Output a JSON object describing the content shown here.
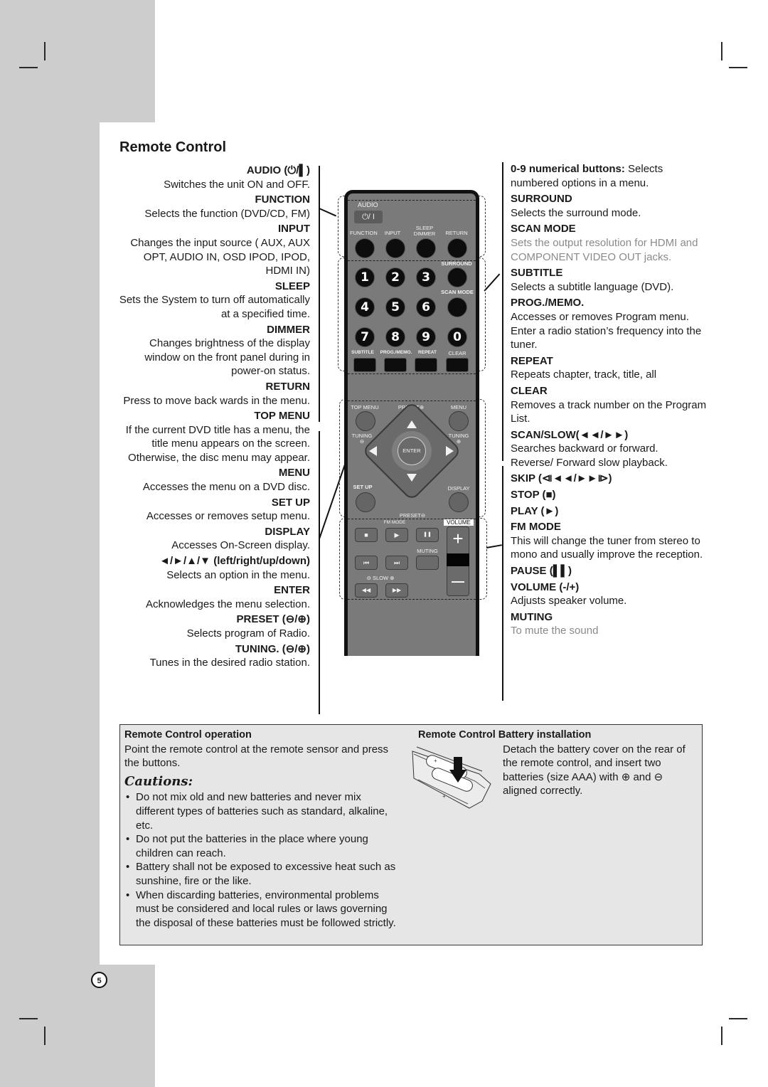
{
  "page": {
    "title": "Remote Control",
    "page_number": "5"
  },
  "left_column": [
    {
      "heading": "AUDIO (⏻/▌)",
      "desc": "Switches the unit ON and OFF."
    },
    {
      "heading": "FUNCTION",
      "desc": "Selects the function (DVD/CD, FM)"
    },
    {
      "heading": "INPUT",
      "desc": "Changes the input source ( AUX, AUX OPT, AUDIO IN, OSD IPOD, IPOD, HDMI IN)"
    },
    {
      "heading": "SLEEP",
      "desc": "Sets the System to turn off automatically at a specified time."
    },
    {
      "heading": "DIMMER",
      "desc": "Changes brightness of the display window on the front panel during in power-on status."
    },
    {
      "heading": "RETURN",
      "desc": "Press to move back wards in the menu."
    },
    {
      "heading": "TOP MENU",
      "desc": "If the current DVD title has a menu, the title menu appears on the screen. Otherwise, the disc menu may appear."
    },
    {
      "heading": "MENU",
      "desc": "Accesses the menu on a DVD disc."
    },
    {
      "heading": "SET UP",
      "desc": "Accesses or removes setup menu."
    },
    {
      "heading": "DISPLAY",
      "desc": "Accesses On-Screen display."
    },
    {
      "heading": "◄/►/▲/▼ (left/right/up/down)",
      "desc": "Selects an option in the menu."
    },
    {
      "heading": "ENTER",
      "desc": "Acknowledges the menu selection."
    },
    {
      "heading": "PRESET (⊖/⊕)",
      "desc": "Selects program of Radio."
    },
    {
      "heading": "TUNING. (⊖/⊕)",
      "desc": "Tunes in the desired radio station."
    }
  ],
  "right_column": {
    "numerical_heading": "0-9 numerical buttons:",
    "numerical_desc": " Selects numbered options in a menu.",
    "items": [
      {
        "heading": "SURROUND",
        "desc": "Selects the surround mode."
      },
      {
        "heading": "SCAN MODE",
        "desc": "Sets the output resolution for HDMI and COMPONENT VIDEO OUT jacks.",
        "gray": true
      },
      {
        "heading": "SUBTITLE",
        "desc": "Selects a subtitle language (DVD)."
      },
      {
        "heading": "PROG./MEMO.",
        "desc": "Accesses or removes Program menu.",
        "desc2": "Enter a radio station’s frequency into the tuner."
      },
      {
        "heading": "REPEAT",
        "desc": "Repeats chapter, track, title, all"
      },
      {
        "heading": "CLEAR",
        "desc": "Removes a track number on the Program List."
      },
      {
        "heading": "SCAN/SLOW(◄◄/►►)",
        "desc": "Searches backward or forward.",
        "desc2": "Reverse/ Forward slow playback."
      },
      {
        "heading": "SKIP (⧏◄◄/►►⧐)"
      },
      {
        "heading": "STOP (■)"
      },
      {
        "heading": "PLAY (►)"
      },
      {
        "heading": "FM MODE",
        "desc": "This will change the tuner from stereo to mono and usually improve the reception."
      },
      {
        "heading": "PAUSE (▌▌)"
      },
      {
        "heading": "VOLUME (-/+)",
        "desc": "Adjusts speaker volume."
      },
      {
        "heading": "MUTING",
        "desc": "To mute the sound",
        "gray": true
      }
    ]
  },
  "remote": {
    "audio": "AUDIO",
    "power": "⏻/ I",
    "function": "FUNCTION",
    "input": "INPUT",
    "sleep_dimmer": "SLEEP\nDIMMER",
    "return": "RETURN",
    "surround": "SURROUND",
    "scan_mode": "SCAN MODE",
    "digits": [
      "1",
      "2",
      "3",
      "4",
      "5",
      "6",
      "7",
      "8",
      "9",
      "0"
    ],
    "subtitle": "SUBTITLE",
    "prog_memo": "PROG./MEMO.",
    "repeat": "REPEAT",
    "clear": "CLEAR",
    "top_menu": "TOP MENU",
    "preset_plus": "PRESET⊕",
    "menu": "MENU",
    "tuning_minus": "TUNING\n⊖",
    "tuning_plus": "TUNING\n⊕",
    "enter": "ENTER",
    "set_up": "SET UP",
    "display": "DISPLAY",
    "preset_minus": "PRESET⊖",
    "fm_mode": "FM MODE",
    "volume": "VOLUME",
    "muting": "MUTING",
    "slow": "⊖  SLOW  ⊕",
    "stop": "■",
    "play": "▶",
    "pause": "❚❚",
    "prev": "⏮",
    "next": "⏭",
    "rew": "◀◀",
    "ffw": "▶▶",
    "vol_up": "+",
    "vol_down": "—"
  },
  "operation": {
    "heading": "Remote Control operation",
    "desc": "Point the remote control at the remote sensor and press the buttons.",
    "cautions_title": "Cautions:",
    "cautions": [
      "Do not mix old and new batteries and never mix different types of batteries such as standard, alkaline, etc.",
      "Do not put the batteries in the place where young children can reach.",
      "Battery shall not be exposed to excessive heat such as sunshine, fire or the like.",
      "When discarding batteries, environmental problems must be considered and local rules or laws governing the disposal of these batteries must be followed strictly."
    ]
  },
  "battery": {
    "heading": "Remote Control Battery installation",
    "desc": "Detach the battery cover on the rear of the remote control, and insert two batteries (size AAA) with ⊕ and ⊖ aligned correctly."
  }
}
